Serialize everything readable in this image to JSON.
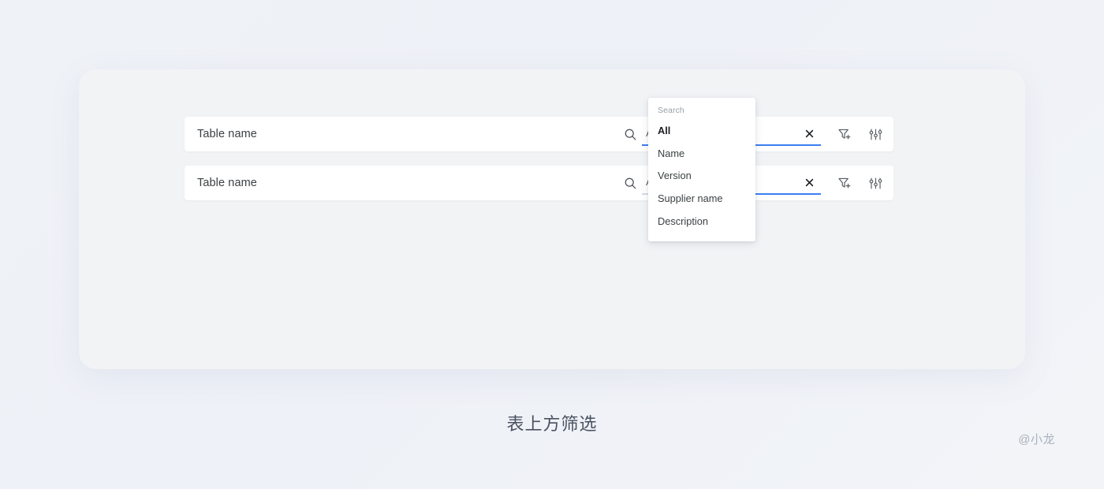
{
  "page": {
    "caption": "表上方筛选",
    "watermark": "@小龙"
  },
  "rows": [
    {
      "table_name": "Table name",
      "search_icon": "search-icon",
      "scope_value": "All",
      "scope_caret_icon": "chevron-down-icon",
      "search_placeholder": "Search",
      "search_value": "",
      "clear_icon": "close-icon",
      "add_filter_icon": "filter-add-icon",
      "settings_icon": "sliders-settings-icon",
      "dropdown_open": false
    },
    {
      "table_name": "Table name",
      "search_icon": "search-icon",
      "scope_value": "All",
      "scope_caret_icon": "chevron-down-icon",
      "search_placeholder": "Search",
      "search_value": "",
      "clear_icon": "close-icon",
      "add_filter_icon": "filter-add-icon",
      "settings_icon": "sliders-settings-icon",
      "dropdown_open": true
    }
  ],
  "dropdown": {
    "title": "Search",
    "items": [
      {
        "label": "All",
        "selected": true
      },
      {
        "label": "Name",
        "selected": false
      },
      {
        "label": "Version",
        "selected": false
      },
      {
        "label": "Supplier name",
        "selected": false
      },
      {
        "label": "Description",
        "selected": false
      }
    ]
  },
  "colors": {
    "accent": "#3b7ef2",
    "muted_underline": "#d3dbe6",
    "panel_bg": "#f1f3f5",
    "page_bg": "#eff2f7",
    "text_primary": "#3c4043",
    "text_muted": "#9aa0a6"
  }
}
